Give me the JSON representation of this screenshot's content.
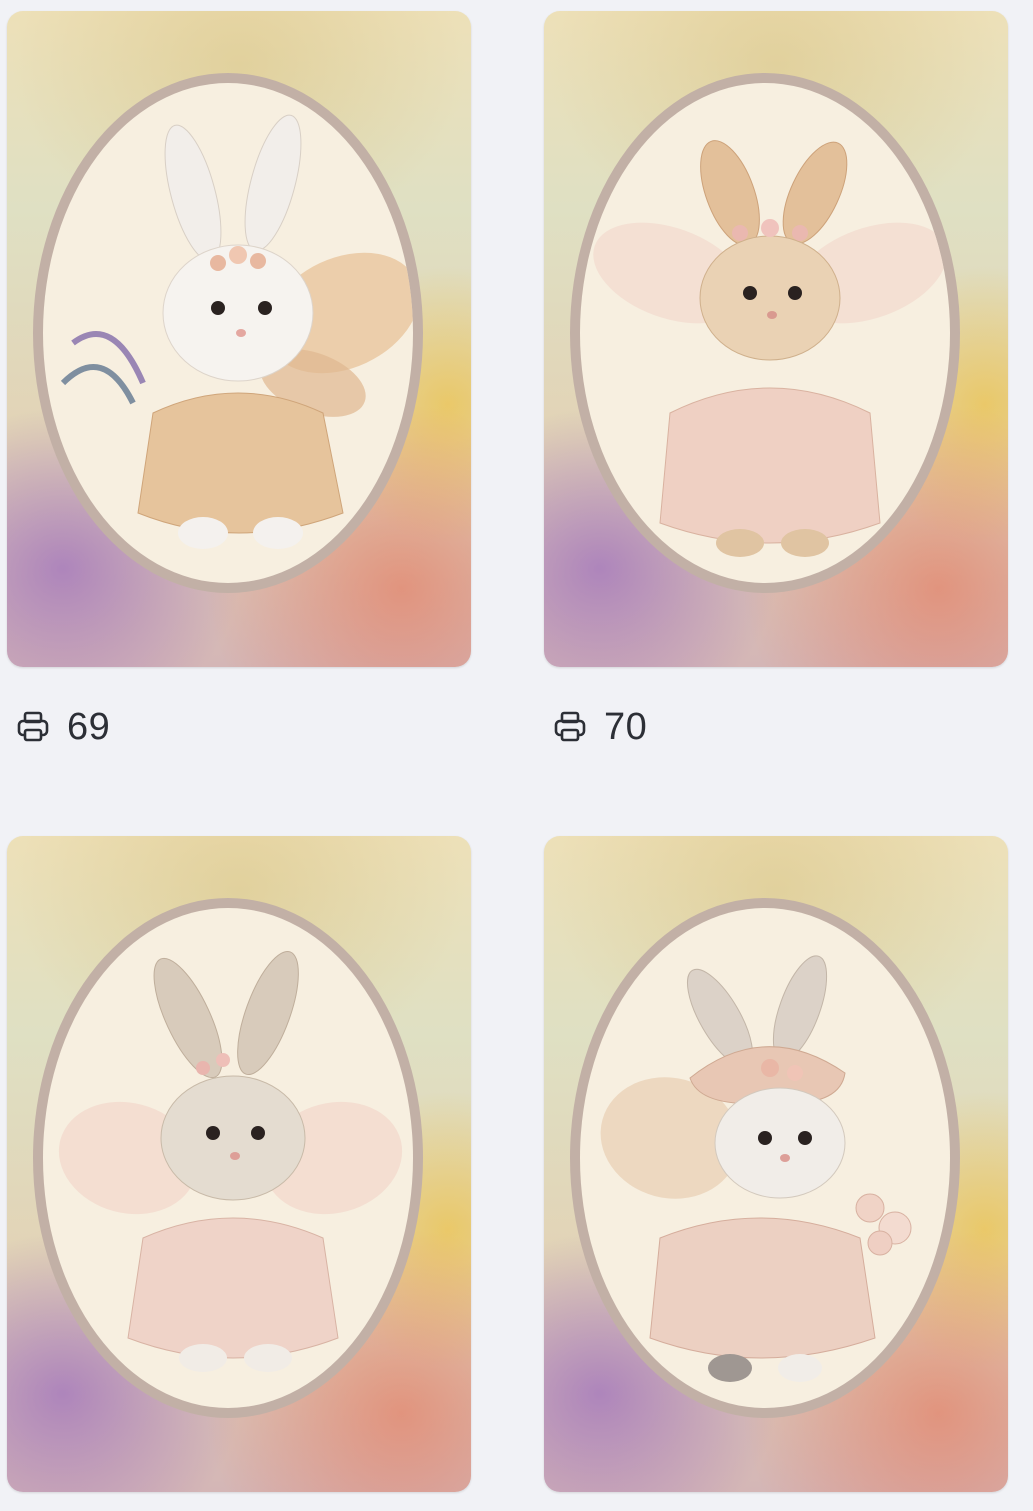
{
  "cards": [
    {
      "alt": "",
      "prints": "69"
    },
    {
      "alt": "",
      "prints": "70"
    },
    {
      "alt": "",
      "prints": ""
    },
    {
      "alt": "",
      "prints": ""
    }
  ],
  "icons": {
    "print": "printer-icon"
  },
  "colors": {
    "page_background": "#f1f2f6",
    "frame": "#c2b0a6",
    "frame_inner": "#f7efe0",
    "text": "#2c2f36"
  }
}
